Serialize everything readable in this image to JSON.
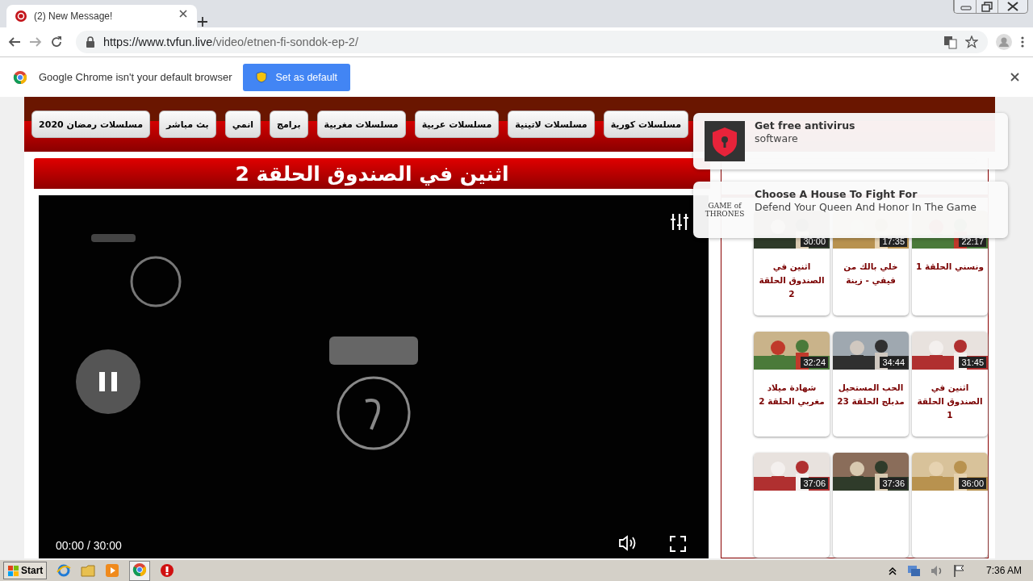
{
  "browser": {
    "tab": {
      "title": "(2) New Message!"
    },
    "url": {
      "host": "https://www.tvfun.live",
      "path": "/video/etnen-fi-sondok-ep-2/"
    },
    "infobar": {
      "message": "Google Chrome isn't your default browser",
      "button": "Set as default"
    }
  },
  "site": {
    "nav": [
      {
        "label": "مسلسلات كورية"
      },
      {
        "label": "مسلسلات لاتينية"
      },
      {
        "label": "مسلسلات عربية"
      },
      {
        "label": "مسلسلات مغربية"
      },
      {
        "label": "برامج"
      },
      {
        "label": "انمي"
      },
      {
        "label": "بث مباشر"
      },
      {
        "label": "مسلسلات رمضان 2020"
      }
    ],
    "title": "اثنين في الصندوق الحلقة 2",
    "player": {
      "kind": "picture",
      "time": "00:00 / 30:00"
    },
    "episodes": [
      {
        "duration": "22:17",
        "title": "ونسني الحلقة 1"
      },
      {
        "duration": "17:35",
        "title": "خلي بالك من فيفي - زينة"
      },
      {
        "duration": "30:00",
        "title": "اثنين في الصندوق الحلقة 2"
      },
      {
        "duration": "31:45",
        "title": "اثنين في الصندوق الحلقة 1"
      },
      {
        "duration": "34:44",
        "title": "الحب المستحيل مدبلج الحلقة 23"
      },
      {
        "duration": "32:24",
        "title": "شهادة ميلاد مغربي الحلقة 2"
      },
      {
        "duration": "36:00"
      },
      {
        "duration": "37:36"
      },
      {
        "duration": "37:06"
      }
    ]
  },
  "notifications": [
    {
      "kind": "shield",
      "title": "Get free antivirus",
      "body": "software"
    },
    {
      "kind": "logo",
      "logo": "GAME of THRONES",
      "title": "Choose A House To Fight For",
      "body": "Defend Your Queen And Honor In The Game"
    }
  ],
  "taskbar": {
    "start": "Start",
    "clock": "7:36 AM"
  }
}
